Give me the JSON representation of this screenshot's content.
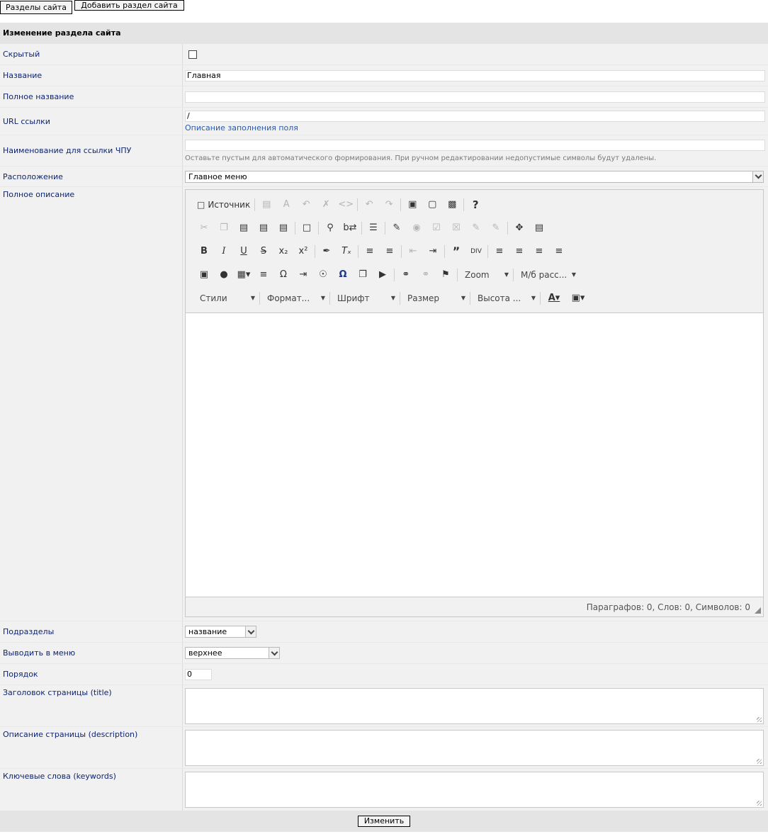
{
  "top_buttons": {
    "sections": "Разделы сайта",
    "add_section": "Добавить раздел сайта"
  },
  "form": {
    "title": "Изменение раздела сайта",
    "hidden": {
      "label": "Скрытый",
      "checked": false
    },
    "name": {
      "label": "Название",
      "value": "Главная"
    },
    "full_name": {
      "label": "Полное название",
      "value": ""
    },
    "url": {
      "label": "URL ссылки",
      "value": "/",
      "hint": "Описание заполнения поля"
    },
    "seo_name": {
      "label": "Наименование для ссылки ЧПУ",
      "value": "",
      "hint": "Оставьте пустым для автоматического формирования. При ручном редактировании недопустимые символы будут удалены."
    },
    "location": {
      "label": "Расположение",
      "value": "Главное меню"
    },
    "description": {
      "label": "Полное описание"
    },
    "subsections": {
      "label": "Подразделы",
      "value": "название"
    },
    "menu": {
      "label": "Выводить в меню",
      "value": "верхнее"
    },
    "order": {
      "label": "Порядок",
      "value": "0"
    },
    "page_title": {
      "label": "Заголовок страницы (title)",
      "value": ""
    },
    "page_description": {
      "label": "Описание страницы (description)",
      "value": ""
    },
    "keywords": {
      "label": "Ключевые слова (keywords)",
      "value": ""
    },
    "submit": "Изменить"
  },
  "editor": {
    "source_label": "Источник",
    "zoom_label": "Zoom",
    "spacing_label": "М/б расс...",
    "styles_label": "Стили",
    "format_label": "Формат...",
    "font_label": "Шрифт",
    "size_label": "Размер",
    "height_label": "Высота ...",
    "status": "Параграфов: 0, Слов: 0, Символов: 0"
  }
}
